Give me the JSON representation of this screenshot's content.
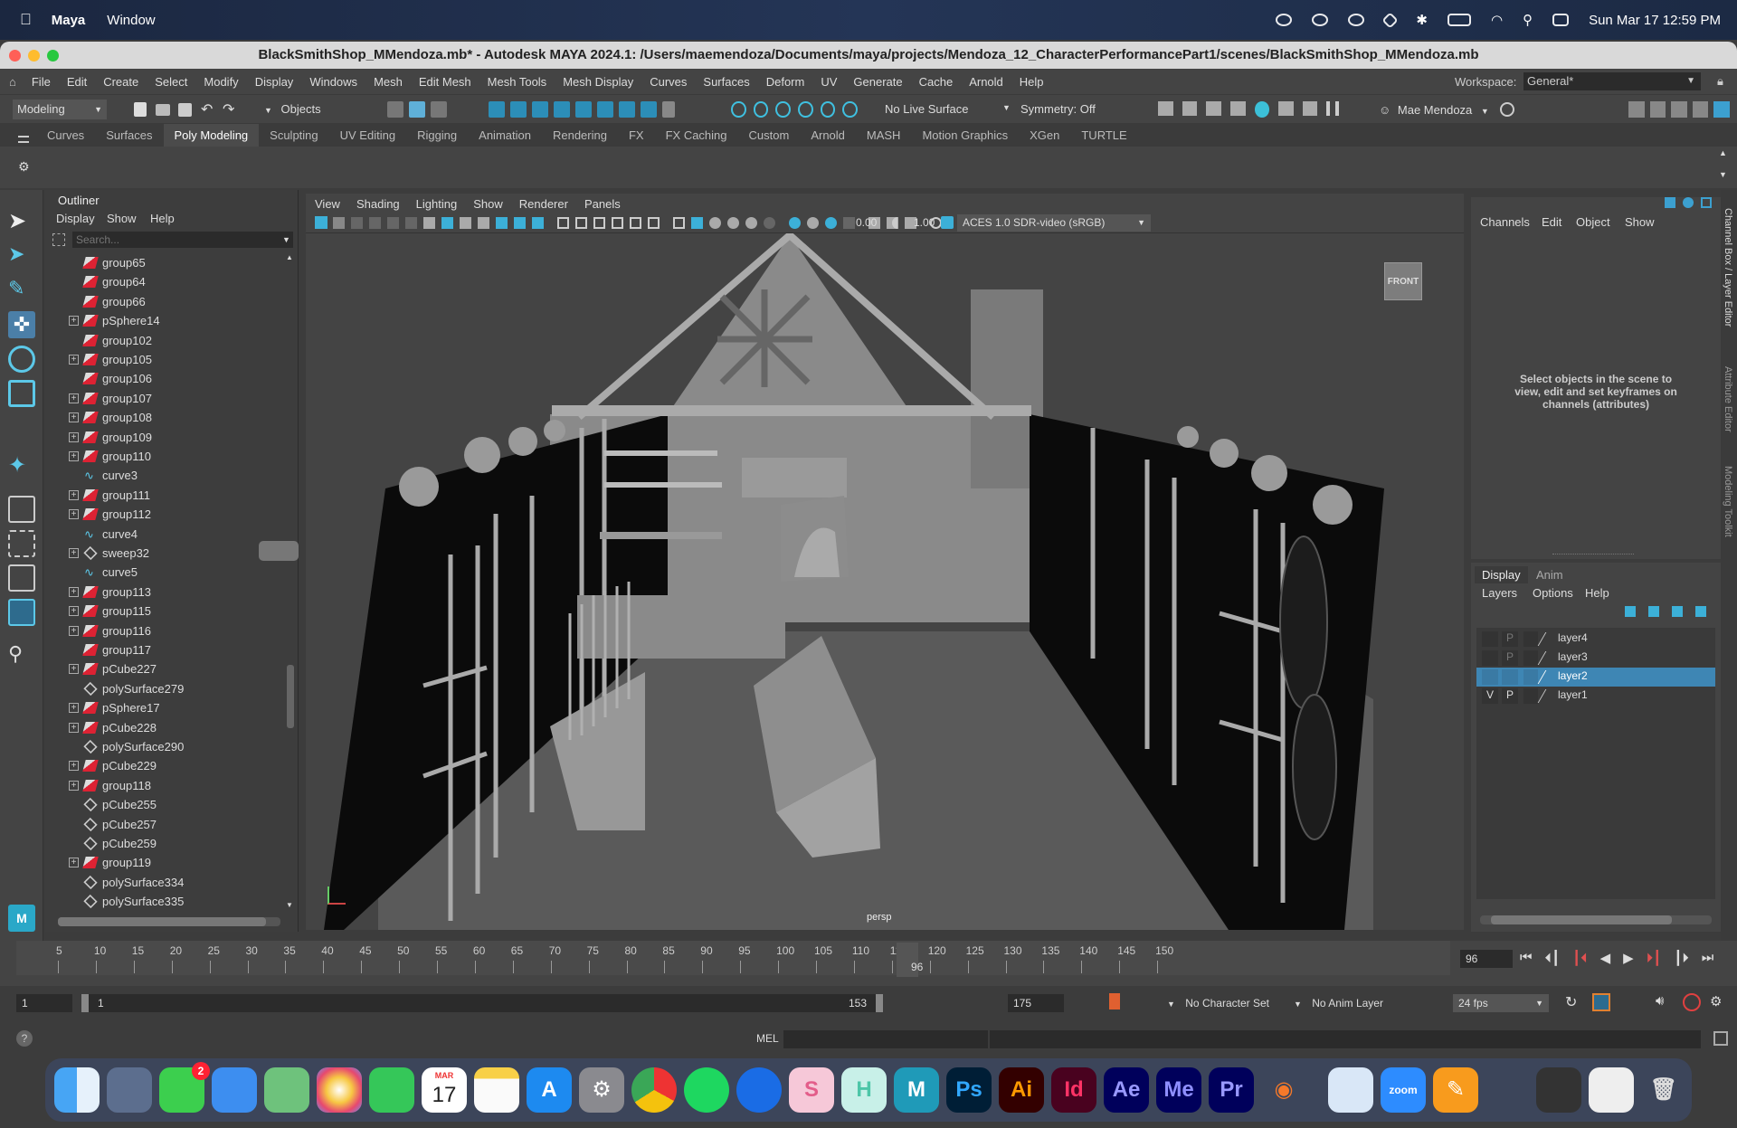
{
  "macos_menubar": {
    "app": "Maya",
    "menus": [
      "Window"
    ],
    "clock": "Sun Mar 17  12:59 PM"
  },
  "window": {
    "title": "BlackSmithShop_MMendoza.mb* - Autodesk MAYA 2024.1: /Users/maemendoza/Documents/maya/projects/Mendoza_12_CharacterPerformancePart1/scenes/BlackSmithShop_MMendoza.mb"
  },
  "main_menu": [
    "File",
    "Edit",
    "Create",
    "Select",
    "Modify",
    "Display",
    "Windows",
    "Mesh",
    "Edit Mesh",
    "Mesh Tools",
    "Mesh Display",
    "Curves",
    "Surfaces",
    "Deform",
    "UV",
    "Generate",
    "Cache",
    "Arnold",
    "Help"
  ],
  "workspace": {
    "label": "Workspace:",
    "value": "General*"
  },
  "status_line": {
    "mode": "Modeling",
    "selection_mode": "Objects",
    "live_surface": "No Live Surface",
    "symmetry": "Symmetry: Off",
    "user": "Mae Mendoza"
  },
  "shelf_tabs": [
    "Curves",
    "Surfaces",
    "Poly Modeling",
    "Sculpting",
    "UV Editing",
    "Rigging",
    "Animation",
    "Rendering",
    "FX",
    "FX Caching",
    "Custom",
    "Arnold",
    "MASH",
    "Motion Graphics",
    "XGen",
    "TURTLE"
  ],
  "shelf_active": "Poly Modeling",
  "outliner": {
    "title": "Outliner",
    "menu": [
      "Display",
      "Show",
      "Help"
    ],
    "search_placeholder": "Search...",
    "items": [
      {
        "name": "group65",
        "type": "group",
        "expand": false
      },
      {
        "name": "group64",
        "type": "group",
        "expand": false
      },
      {
        "name": "group66",
        "type": "group",
        "expand": false
      },
      {
        "name": "pSphere14",
        "type": "group",
        "expand": true
      },
      {
        "name": "group102",
        "type": "group",
        "expand": false
      },
      {
        "name": "group105",
        "type": "group",
        "expand": true
      },
      {
        "name": "group106",
        "type": "group",
        "expand": false
      },
      {
        "name": "group107",
        "type": "group",
        "expand": true
      },
      {
        "name": "group108",
        "type": "group",
        "expand": true
      },
      {
        "name": "group109",
        "type": "group",
        "expand": true
      },
      {
        "name": "group110",
        "type": "group",
        "expand": true
      },
      {
        "name": "curve3",
        "type": "curve",
        "expand": false
      },
      {
        "name": "group111",
        "type": "group",
        "expand": true
      },
      {
        "name": "group112",
        "type": "group",
        "expand": true
      },
      {
        "name": "curve4",
        "type": "curve",
        "expand": false
      },
      {
        "name": "sweep32",
        "type": "mesh",
        "expand": true
      },
      {
        "name": "curve5",
        "type": "curve",
        "expand": false
      },
      {
        "name": "group113",
        "type": "group",
        "expand": true
      },
      {
        "name": "group115",
        "type": "group",
        "expand": true
      },
      {
        "name": "group116",
        "type": "group",
        "expand": true
      },
      {
        "name": "group117",
        "type": "group",
        "expand": false
      },
      {
        "name": "pCube227",
        "type": "group",
        "expand": true
      },
      {
        "name": "polySurface279",
        "type": "mesh",
        "expand": false
      },
      {
        "name": "pSphere17",
        "type": "group",
        "expand": true
      },
      {
        "name": "pCube228",
        "type": "group",
        "expand": true
      },
      {
        "name": "polySurface290",
        "type": "mesh",
        "expand": false
      },
      {
        "name": "pCube229",
        "type": "group",
        "expand": true
      },
      {
        "name": "group118",
        "type": "group",
        "expand": true
      },
      {
        "name": "pCube255",
        "type": "mesh",
        "expand": false
      },
      {
        "name": "pCube257",
        "type": "mesh",
        "expand": false
      },
      {
        "name": "pCube259",
        "type": "mesh",
        "expand": false
      },
      {
        "name": "group119",
        "type": "group",
        "expand": true
      },
      {
        "name": "polySurface334",
        "type": "mesh",
        "expand": false
      },
      {
        "name": "polySurface335",
        "type": "mesh",
        "expand": false
      }
    ]
  },
  "viewport": {
    "menu": [
      "View",
      "Shading",
      "Lighting",
      "Show",
      "Renderer",
      "Panels"
    ],
    "exposure": "0.00",
    "gamma": "1.00",
    "color_space": "ACES 1.0 SDR-video (sRGB)",
    "camera_label": "persp",
    "viewcube_label": "FRONT"
  },
  "channel_box": {
    "menu": [
      "Channels",
      "Edit",
      "Object",
      "Show"
    ],
    "hint": "Select objects in the scene to view, edit and set keyframes on channels (attributes)"
  },
  "side_tabs": [
    "Channel Box / Layer Editor",
    "Attribute Editor",
    "Modeling Toolkit"
  ],
  "layer_editor": {
    "tabs": [
      "Display",
      "Anim"
    ],
    "active_tab": "Display",
    "menu": [
      "Layers",
      "Options",
      "Help"
    ],
    "layers": [
      {
        "name": "layer4",
        "v": "",
        "p": "P",
        "selected": false
      },
      {
        "name": "layer3",
        "v": "",
        "p": "P",
        "selected": false
      },
      {
        "name": "layer2",
        "v": "",
        "p": "P",
        "selected": true
      },
      {
        "name": "layer1",
        "v": "V",
        "p": "P",
        "selected": false
      }
    ]
  },
  "timeline": {
    "ticks": [
      "5",
      "10",
      "15",
      "20",
      "25",
      "30",
      "35",
      "40",
      "45",
      "50",
      "55",
      "60",
      "65",
      "70",
      "75",
      "80",
      "85",
      "90",
      "95",
      "100",
      "105",
      "110",
      "115",
      "120",
      "125",
      "130",
      "135",
      "140",
      "145",
      "150"
    ],
    "current_frame": "96",
    "current_frame_field": "96"
  },
  "range_slider": {
    "start": "1",
    "inner_start": "1",
    "inner_end": "153",
    "end": "175",
    "character_set": "No Character Set",
    "anim_layer": "No Anim Layer",
    "fps": "24 fps"
  },
  "command_line": {
    "label": "MEL"
  },
  "dock": {
    "messages_badge": "2",
    "calendar_month": "MAR",
    "calendar_day": "17",
    "apps": [
      "Finder",
      "Launchpad",
      "Messages",
      "Mail",
      "Maps",
      "Photos",
      "FaceTime",
      "Calendar",
      "Notes",
      "App Store",
      "System Settings",
      "Chrome",
      "Spotify",
      "1Password",
      "S",
      "H",
      "Maya",
      "Ps",
      "Ai",
      "Id",
      "Ae",
      "Me",
      "Pr",
      "Blender",
      "Preview",
      "Zoom",
      "Pages",
      "Activity",
      "Trash"
    ]
  }
}
